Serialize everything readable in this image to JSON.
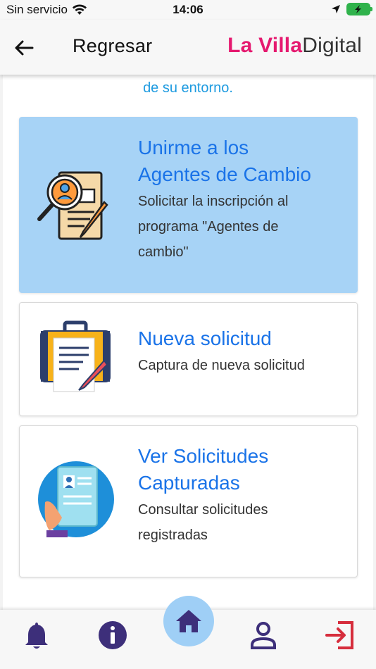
{
  "status_bar": {
    "carrier": "Sin servicio",
    "time": "14:06"
  },
  "header": {
    "back_label": "Regresar",
    "logo_brand": "La Villa",
    "logo_suffix": "Digital"
  },
  "intro_text": "de su entorno.",
  "cards": [
    {
      "title_line1": "Unirme a los",
      "title_line2": "Agentes de Cambio",
      "desc_line1": "Solicitar la inscripción al",
      "desc_line2": "programa \"Agentes de",
      "desc_line3": "cambio\"",
      "icon": "magnifier-document-pencil-icon"
    },
    {
      "title_line1": "Nueva solicitud",
      "desc_line1": "Captura de nueva solicitud",
      "icon": "briefcase-document-pencil-icon"
    },
    {
      "title_line1": "Ver Solicitudes",
      "title_line2": "Capturadas",
      "desc_line1": "Consultar solicitudes",
      "desc_line2": "registradas",
      "icon": "hand-id-card-icon"
    }
  ],
  "bottom_nav": [
    "bell-icon",
    "info-icon",
    "home-icon",
    "user-icon",
    "logout-icon"
  ],
  "colors": {
    "accent_blue": "#1a73e8",
    "intro_blue": "#1e9be0",
    "highlight_card": "#a7d3f6",
    "brand_pink": "#e5196f",
    "nav_purple": "#3d2f7a",
    "logout_red": "#d62d3c"
  }
}
